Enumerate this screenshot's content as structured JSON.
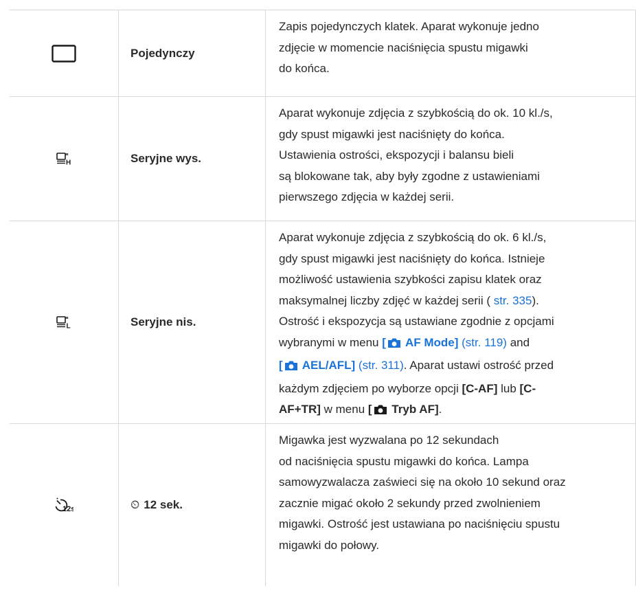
{
  "rows": [
    {
      "icon": "single-frame-icon",
      "name": "Pojedynczy",
      "lines": [
        "Zapis pojedynczych klatek. Aparat wykonuje jedno",
        "zdjęcie w momencie naciśnięcia spustu migawki",
        "do końca."
      ]
    },
    {
      "icon": "sequential-high-icon",
      "name": "Seryjne wys.",
      "lines": [
        "Aparat wykonuje zdjęcia z szybkością do ok. 10 kl./s,",
        "gdy spust migawki jest naciśnięty do końca.",
        "Ustawienia ostrości, ekspozycji i balansu bieli",
        "są blokowane tak, aby były zgodne z ustawieniami",
        "pierwszego zdjęcia w każdej serii."
      ]
    },
    {
      "icon": "sequential-low-icon",
      "name": "Seryjne nis.",
      "l1": "Aparat wykonuje zdjęcia z szybkością do ok. 6 kl./s,",
      "l2": "gdy spust migawki jest naciśnięty do końca. Istnieje",
      "l3": "możliwość ustawienia szybkości zapisu klatek oraz",
      "l4a": "maksymalnej liczby zdjęć w każdej serii (",
      "l4link": " str. 335",
      "l4b": ").",
      "l5": "Ostrość i ekspozycja są ustawiane zgodnie z opcjami",
      "l6a": "wybranymi w menu ",
      "l6menu_open": "[",
      "l6menu": " AF Mode]",
      "l6ref": " (str. 119)",
      "l6b": " and",
      "l7menu_open": "[",
      "l7menu": " AEL/AFL]",
      "l7ref": " (str. 311)",
      "l7b": ". Aparat ustawi ostrość przed",
      "l8a": "każdym zdjęciem po wyborze opcji ",
      "l8opt1": "[C-AF]",
      "l8mid": " lub ",
      "l8opt2a": "[C-",
      "l9opt2b": "AF+TR]",
      "l9a": " w menu ",
      "l9menu_open": "[",
      "l9menu": " Tryb AF]",
      "l9b": "."
    },
    {
      "icon": "self-timer-12s-icon",
      "name": "12 sek.",
      "name_prefix": "⏲",
      "lines": [
        "Migawka jest wyzwalana po 12 sekundach",
        "od naciśnięcia spustu migawki do końca. Lampa",
        "samowyzwalacza zaświeci się na około 10 sekund oraz",
        "zacznie migać około 2 sekundy przed zwolnieniem",
        "migawki. Ostrość jest ustawiana po naciśnięciu spustu",
        "migawki do połowy."
      ]
    }
  ]
}
